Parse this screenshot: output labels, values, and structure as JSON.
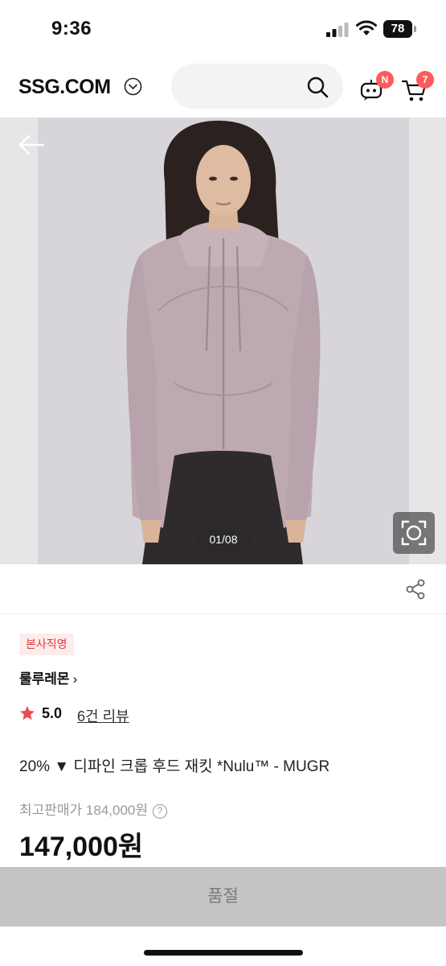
{
  "status_bar": {
    "time": "9:36",
    "battery": "78"
  },
  "header": {
    "logo": "SSG.COM",
    "search": {
      "icon": "search-icon"
    },
    "bot_badge": "N",
    "cart_count": "7"
  },
  "gallery": {
    "counter": "01/08"
  },
  "product": {
    "badge": "본사직영",
    "brand": "룰루레몬",
    "brand_chevron": "›",
    "rating": "5.0",
    "review_text": "6건 리뷰",
    "title": "20% ▼ 디파인 크롭 후드 재킷 *Nulu™ - MUGR",
    "lowest_price_label": "최고판매가 184,000원",
    "price": "147,000원"
  },
  "bottom": {
    "sold_out_label": "품절"
  },
  "colors": {
    "accent": "#ff5a5a",
    "badge_bg": "#fdecec",
    "badge_text": "#e03a3a",
    "sold_out_bg": "#c4c4c4"
  }
}
